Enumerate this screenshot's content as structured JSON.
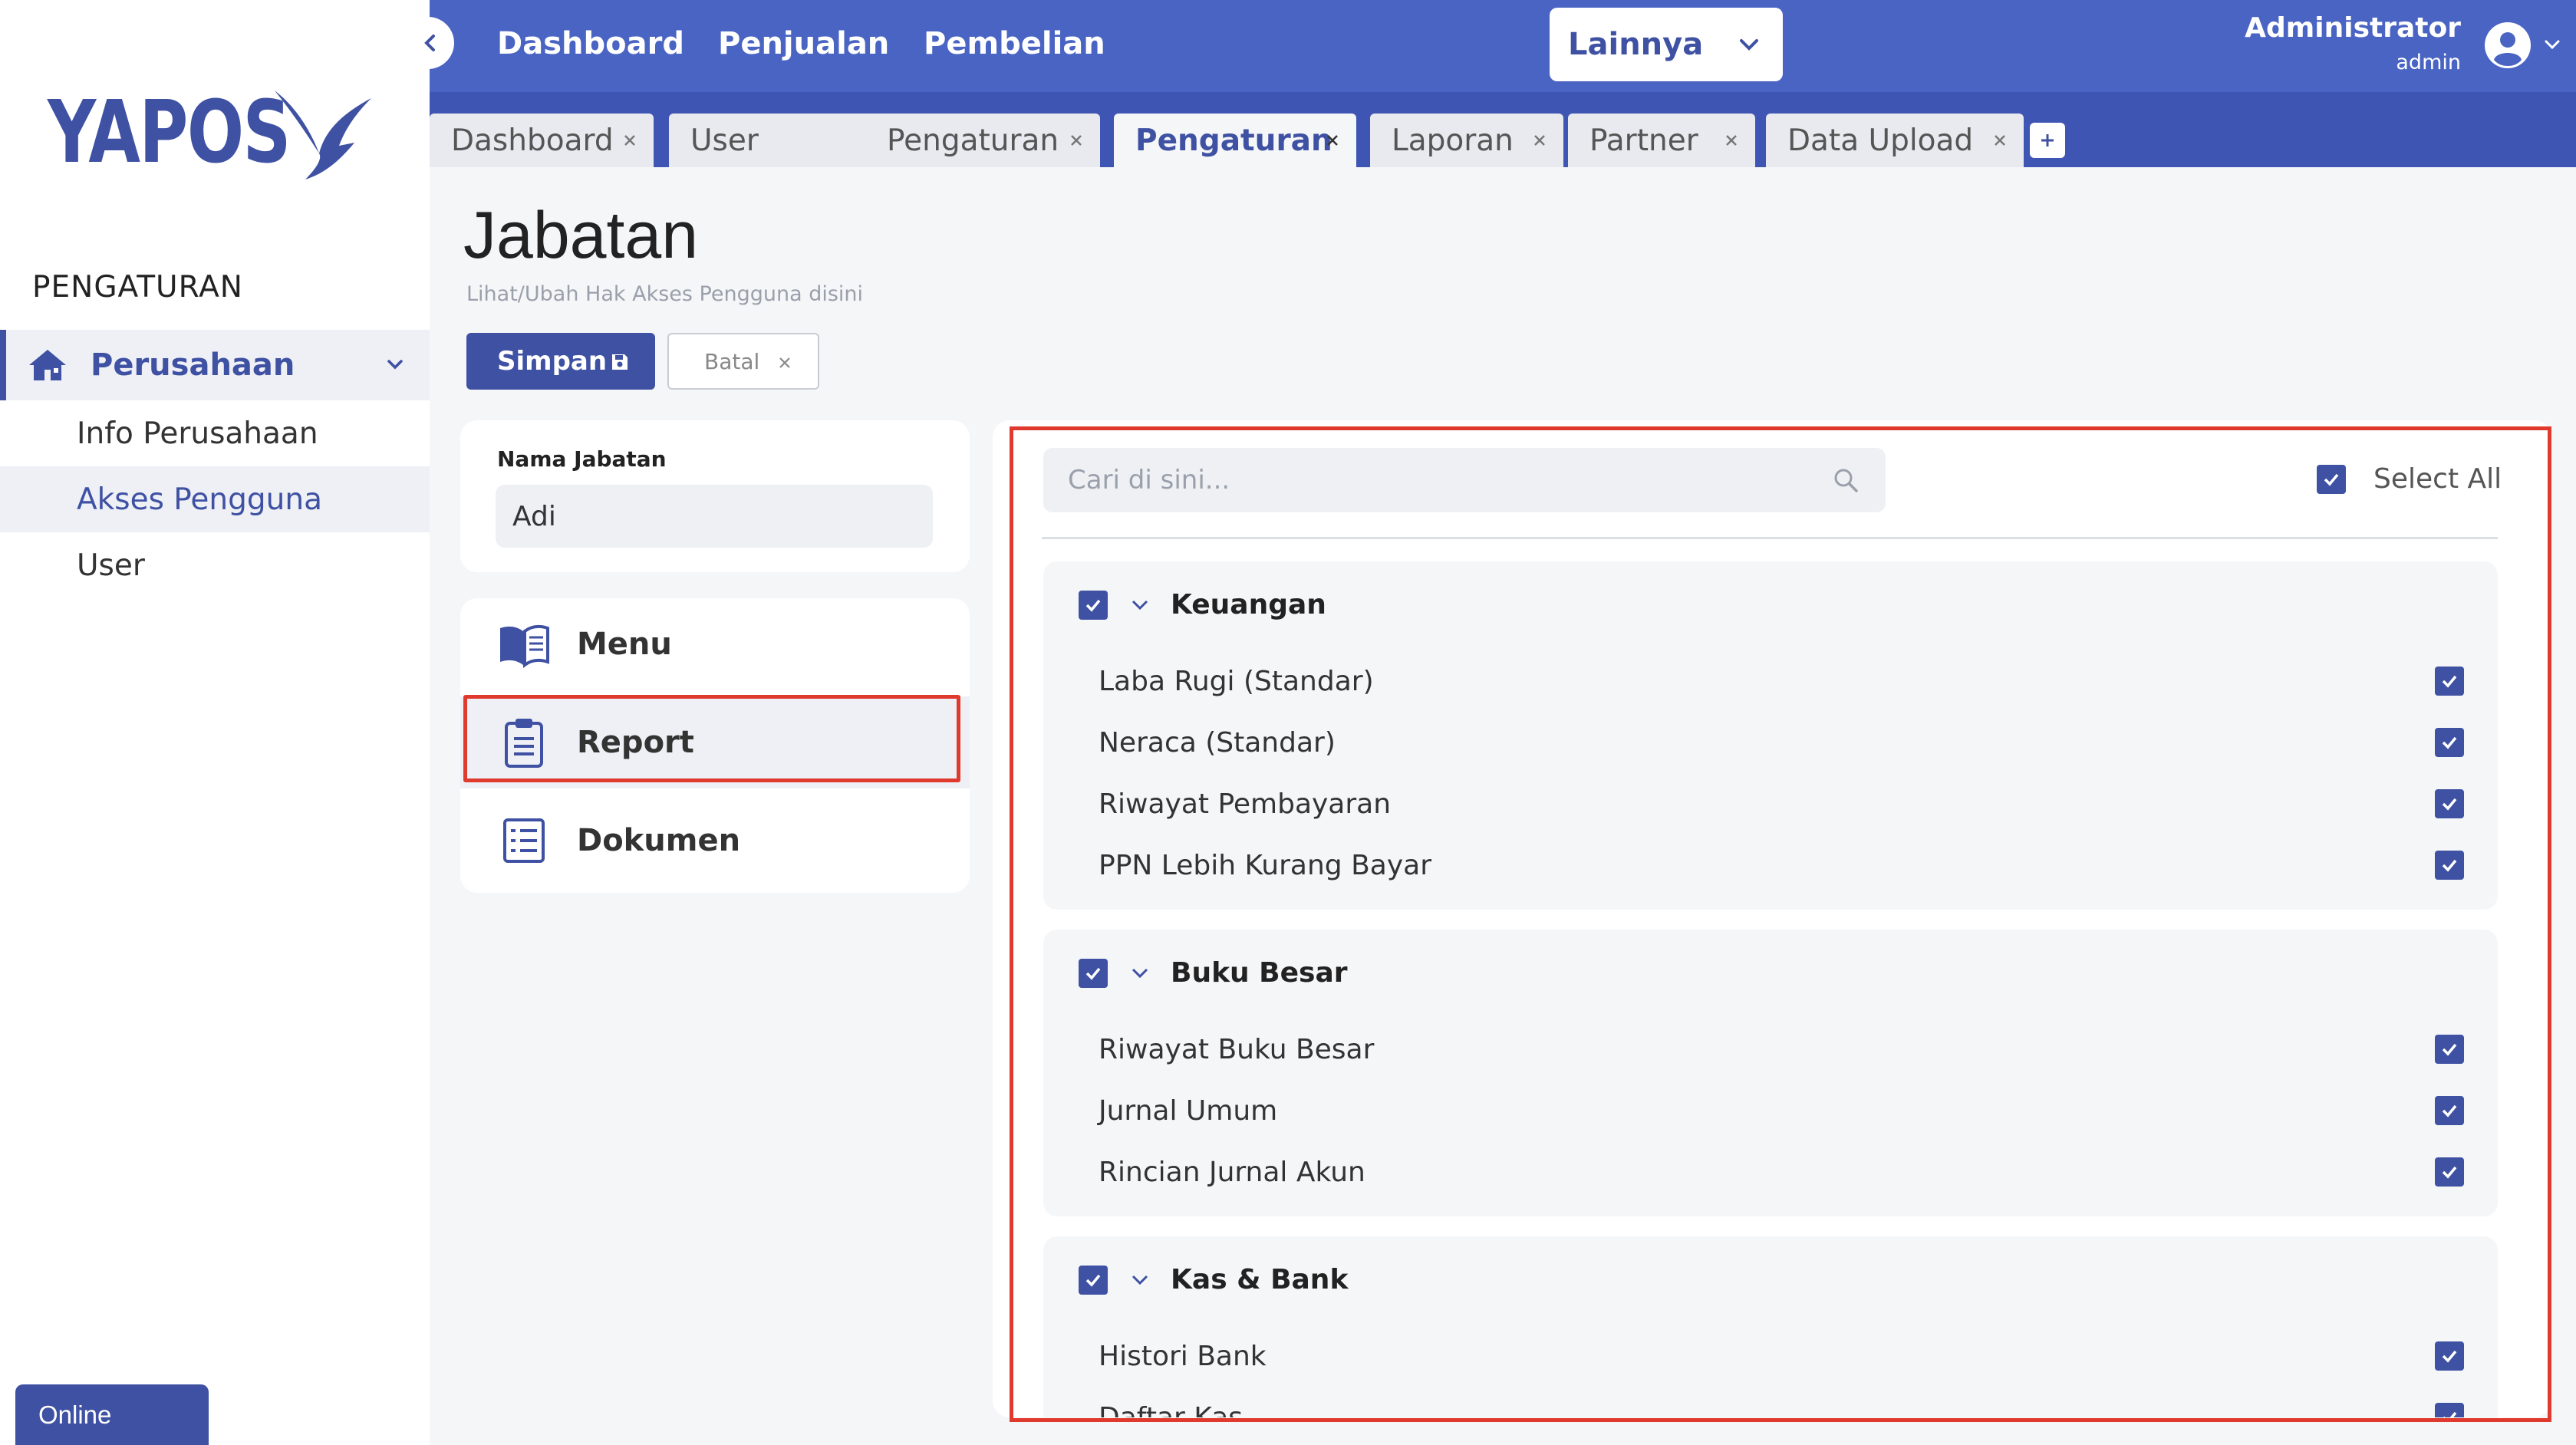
{
  "brand": {
    "name": "YAPOS",
    "accent": "#3f51a3",
    "topbar": "#4a64c3",
    "highlight": "#e03a2e"
  },
  "sidebar": {
    "section_title": "PENGATURAN",
    "parent": {
      "label": "Perusahaan",
      "icon": "home-icon"
    },
    "items": [
      {
        "label": "Info Perusahaan"
      },
      {
        "label": "Akses Pengguna"
      },
      {
        "label": "User"
      }
    ],
    "status": "Online"
  },
  "topnav": {
    "items": [
      "Dashboard",
      "Penjualan",
      "Pembelian"
    ],
    "more": "Lainnya",
    "user": {
      "name": "Administrator",
      "role": "admin"
    }
  },
  "tabs": [
    "Dashboard",
    "User",
    "Pengaturan",
    "Pengaturan",
    "Laporan",
    "Partner",
    "Data Upload"
  ],
  "page": {
    "title": "Jabatan",
    "subtitle": "Lihat/Ubah Hak Akses Pengguna disini",
    "save_label": "Simpan",
    "cancel_label": "Batal"
  },
  "form": {
    "name_label": "Nama Jabatan",
    "name_value": "Adi"
  },
  "menu": [
    {
      "label": "Menu",
      "icon": "book-icon"
    },
    {
      "label": "Report",
      "icon": "clipboard-icon"
    },
    {
      "label": "Dokumen",
      "icon": "list-icon"
    }
  ],
  "permissions": {
    "search_placeholder": "Cari di sini...",
    "select_all_label": "Select All",
    "groups": [
      {
        "title": "Keuangan",
        "items": [
          "Laba Rugi (Standar)",
          "Neraca (Standar)",
          "Riwayat Pembayaran",
          "PPN Lebih Kurang Bayar"
        ]
      },
      {
        "title": "Buku Besar",
        "items": [
          "Riwayat Buku Besar",
          "Jurnal Umum",
          "Rincian Jurnal Akun"
        ]
      },
      {
        "title": "Kas & Bank",
        "items": [
          "Histori Bank",
          "Daftar Kas"
        ]
      }
    ]
  }
}
